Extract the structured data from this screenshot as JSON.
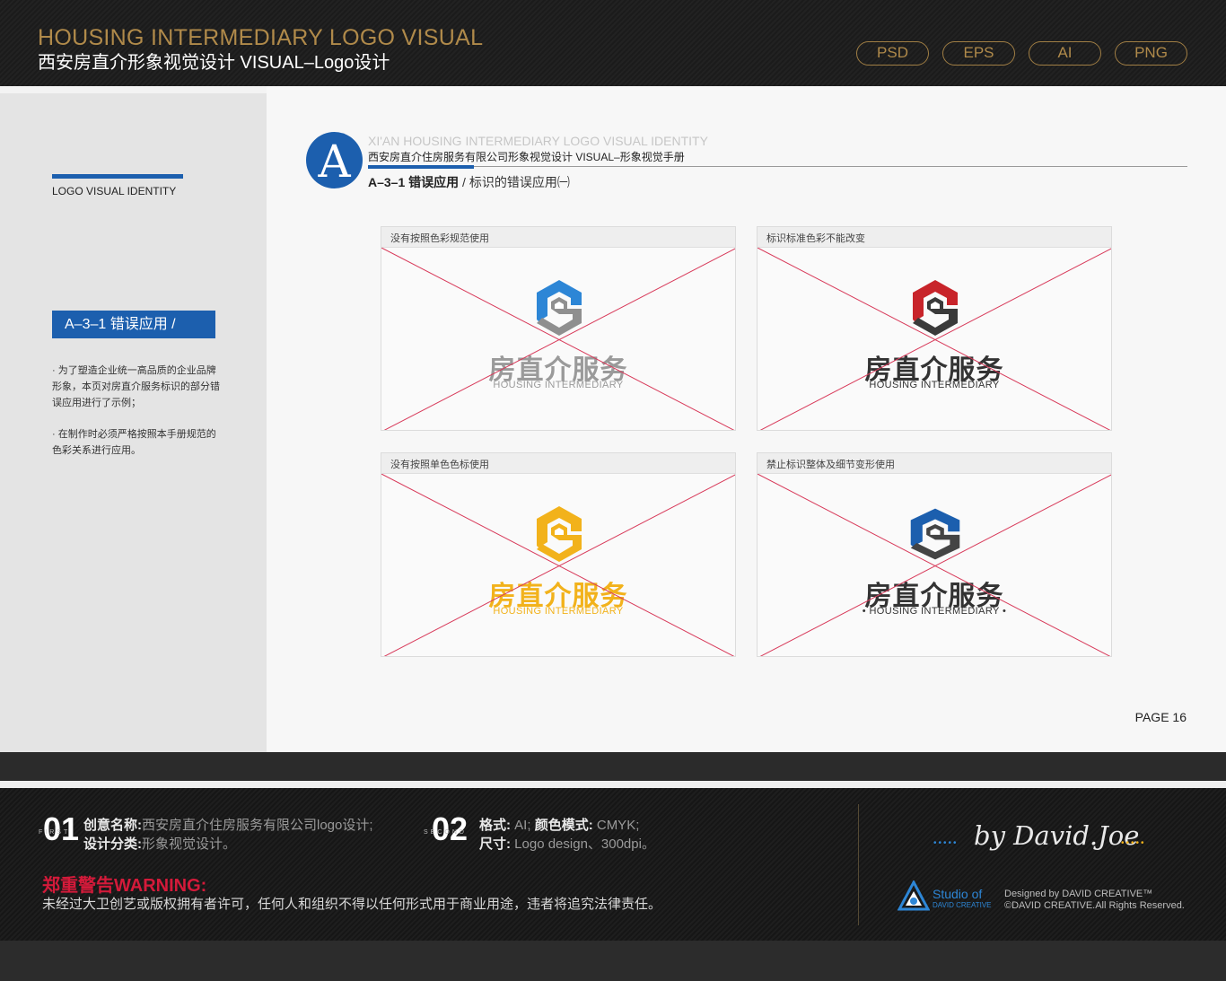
{
  "header": {
    "title_en": "HOUSING INTERMEDIARY LOGO VISUAL",
    "title_cn": "西安房直介形象视觉设计  VISUAL–Logo设计",
    "formats": [
      "PSD",
      "EPS",
      "AI",
      "PNG"
    ]
  },
  "sidebar": {
    "label": "LOGO VISUAL IDENTITY",
    "section_tag": "A–3–1 错误应用 /",
    "note_1": "· 为了塑造企业统一高品质的企业品牌形象，本页对房直介服务标识的部分错误应用进行了示例；",
    "note_2": "· 在制作时必须严格按照本手册规范的色彩关系进行应用。"
  },
  "content": {
    "letter": "A",
    "heading_en": "XI'AN HOUSING INTERMEDIARY LOGO VISUAL IDENTITY",
    "heading_cn": "西安房直介住房服务有限公司形象视觉设计  VISUAL–形象视觉手册",
    "sub_bold": "A–3–1 错误应用",
    "sub_rest": " / 标识的错误应用㈠",
    "page": "PAGE 16"
  },
  "logo": {
    "name_cn": "房直介服务",
    "name_en": "HOUSING INTERMEDIARY",
    "name_en_dotted": "• HOUSING INTERMEDIARY •"
  },
  "cards": [
    {
      "title": "没有按照色彩规范使用",
      "variant": "wrong-colors",
      "c1": "#2d86d6",
      "c2": "#8f8f8f",
      "text_color": "#9a9a9a"
    },
    {
      "title": "标识标准色彩不能改变",
      "variant": "changed-colors",
      "c1": "#c8242a",
      "c2": "#3a3a3a",
      "text_color": "#333333"
    },
    {
      "title": "没有按照单色色标使用",
      "variant": "wrong-mono",
      "c1": "#f2b21b",
      "c2": "#f2b21b",
      "text_color": "#f2b21b"
    },
    {
      "title": "禁止标识整体及细节变形使用",
      "variant": "distorted",
      "c1": "#1c5fae",
      "c2": "#444444",
      "text_color": "#333333"
    }
  ],
  "footer": {
    "num_1": "01",
    "num_1_sub": "FIRST",
    "creative_label": "创意名称:",
    "creative_value": "西安房直介住房服务有限公司logo设计;",
    "category_label": "设计分类:",
    "category_value": "形象视觉设计。",
    "num_2": "02",
    "num_2_sub": "SECOND",
    "format_label": "格式:",
    "format_value": "AI;",
    "color_label": "颜色模式:",
    "color_value": "CMYK;",
    "size_label": "尺寸:",
    "size_value": "Logo design、300dpi。",
    "warning_title": "郑重警告WARNING:",
    "warning_text": "未经过大卫创艺或版权拥有者许可，任何人和组织不得以任何形式用于商业用途，违者将追究法律责任。",
    "signature": "by David.Joe",
    "studio": "Studio of",
    "studio_sub": "DAVID CREATIVE",
    "designed_by": "Designed by DAVID CREATIVE™",
    "rights": "©DAVID CREATIVE.All Rights Reserved."
  },
  "colors": {
    "brand_blue": "#1c5fae",
    "gold": "#b08a4a",
    "warning_red": "#d41a3a",
    "cross_red": "#d83a5a"
  }
}
